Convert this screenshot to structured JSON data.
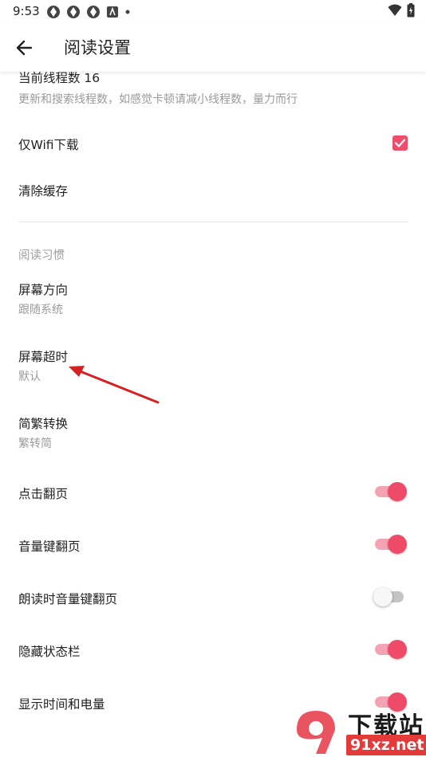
{
  "status_bar": {
    "time": "9:53"
  },
  "app_bar": {
    "title": "阅读设置"
  },
  "items": [
    {
      "title": "当前线程数 16",
      "subtitle": "更新和搜索线程数，如感觉卡顿请减小线程数，量力而行"
    },
    {
      "title": "仅Wifi下载",
      "checked": true
    },
    {
      "title": "清除缓存"
    }
  ],
  "section": {
    "label": "阅读习惯"
  },
  "habit_items": [
    {
      "title": "屏幕方向",
      "subtitle": "跟随系统"
    },
    {
      "title": "屏幕超时",
      "subtitle": "默认"
    },
    {
      "title": "简繁转换",
      "subtitle": "繁转简"
    }
  ],
  "toggles": [
    {
      "label": "点击翻页",
      "on": true
    },
    {
      "label": "音量键翻页",
      "on": true
    },
    {
      "label": "朗读时音量键翻页",
      "on": false
    },
    {
      "label": "隐藏状态栏",
      "on": true
    },
    {
      "label": "显示时间和电量",
      "on": true
    }
  ],
  "colors": {
    "accent": "#ec4e6b",
    "annotation": "#d42222"
  },
  "watermark": {
    "top": "下载站",
    "bottom": "91xz.net"
  }
}
